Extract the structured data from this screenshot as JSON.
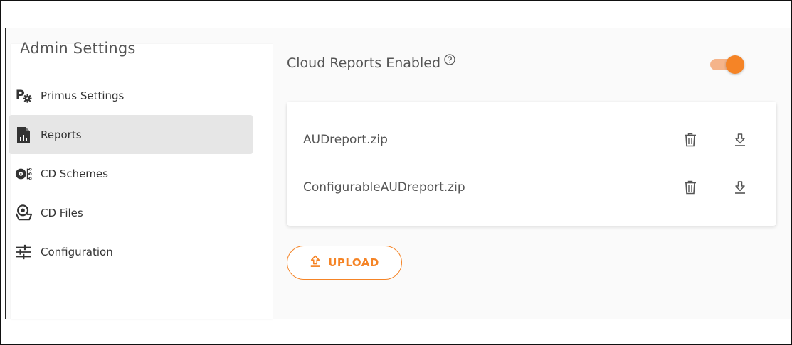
{
  "sidebar": {
    "title": "Admin Settings",
    "items": [
      {
        "label": "Primus Settings",
        "icon": "primus-settings-icon",
        "active": false
      },
      {
        "label": "Reports",
        "icon": "report-document-icon",
        "active": true
      },
      {
        "label": "CD Schemes",
        "icon": "cd-schemes-icon",
        "active": false
      },
      {
        "label": "CD Files",
        "icon": "cd-files-icon",
        "active": false
      },
      {
        "label": "Configuration",
        "icon": "sliders-icon",
        "active": false
      }
    ]
  },
  "main": {
    "title": "Cloud Reports Enabled",
    "help_icon": "help-circle-icon",
    "toggle_on": true,
    "files": [
      {
        "name": "AUDreport.zip"
      },
      {
        "name": "ConfigurableAUDreport.zip"
      }
    ],
    "upload_label": "UPLOAD"
  },
  "colors": {
    "accent": "#f58426",
    "accent_light": "#f5b48a",
    "active_item_bg": "#e6e6e6"
  }
}
